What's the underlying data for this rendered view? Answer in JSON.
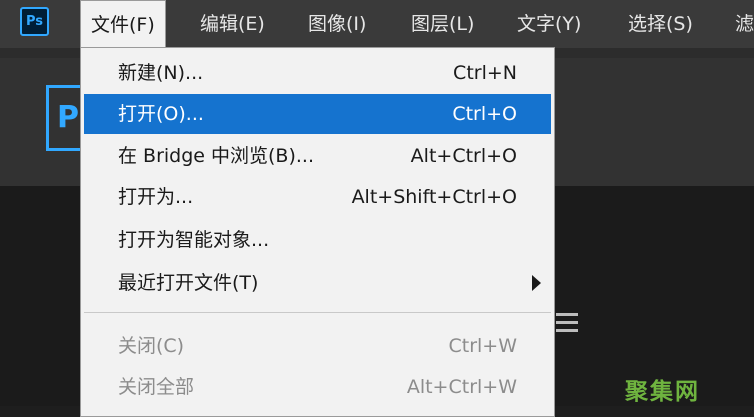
{
  "app": {
    "logo_text": "Ps",
    "accent": "#31a8ff"
  },
  "menubar": {
    "items": [
      "文件(F)",
      "编辑(E)",
      "图像(I)",
      "图层(L)",
      "文字(Y)",
      "选择(S)",
      "滤"
    ]
  },
  "background": {
    "logo_letter": "P"
  },
  "file_menu": {
    "highlight_color": "#1573cf",
    "items": [
      {
        "label": "新建(N)...",
        "shortcut": "Ctrl+N"
      },
      {
        "label": "打开(O)...",
        "shortcut": "Ctrl+O",
        "highlighted": true
      },
      {
        "label": "在 Bridge 中浏览(B)...",
        "shortcut": "Alt+Ctrl+O"
      },
      {
        "label": "打开为...",
        "shortcut": "Alt+Shift+Ctrl+O"
      },
      {
        "label": "打开为智能对象...",
        "shortcut": ""
      },
      {
        "label": "最近打开文件(T)",
        "shortcut": "",
        "submenu": true
      },
      {
        "label": "关闭(C)",
        "shortcut": "Ctrl+W",
        "disabled": true
      },
      {
        "label": "关闭全部",
        "shortcut": "Alt+Ctrl+W",
        "disabled": true
      }
    ]
  },
  "watermark": {
    "text": "聚集网",
    "color": "#6fb43f"
  }
}
